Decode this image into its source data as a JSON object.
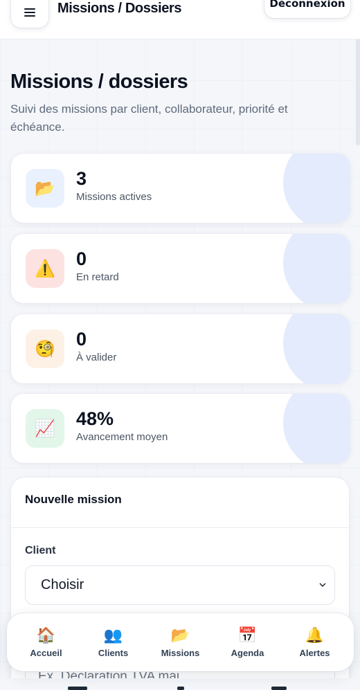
{
  "header": {
    "title": "Missions / Dossiers",
    "logout_label": "Déconnexion"
  },
  "page": {
    "title": "Missions / dossiers",
    "subtitle": "Suivi des missions par client, collaborateur, priorité et échéance."
  },
  "stats": [
    {
      "icon": "folder-icon",
      "glyph": "📂",
      "value": "3",
      "label": "Missions actives",
      "icon_bg": "#eaf1fe"
    },
    {
      "icon": "warning-icon",
      "glyph": "⚠️",
      "value": "0",
      "label": "En retard",
      "icon_bg": "#fde2e2"
    },
    {
      "icon": "monocle-face-icon",
      "glyph": "🧐",
      "value": "0",
      "label": "À valider",
      "icon_bg": "#fdf1e6"
    },
    {
      "icon": "chart-increasing-icon",
      "glyph": "📈",
      "value": "48%",
      "label": "Avancement moyen",
      "icon_bg": "#e2f6e9"
    }
  ],
  "form": {
    "title": "Nouvelle mission",
    "client_label": "Client",
    "client_selected": "Choisir",
    "mission_placeholder": "Ex. Déclaration TVA mai"
  },
  "nav": [
    {
      "icon": "house-icon",
      "glyph": "🏠",
      "label": "Accueil"
    },
    {
      "icon": "people-icon",
      "glyph": "👥",
      "label": "Clients"
    },
    {
      "icon": "folder-icon",
      "glyph": "📂",
      "label": "Missions"
    },
    {
      "icon": "calendar-icon",
      "glyph": "📅",
      "label": "Agenda"
    },
    {
      "icon": "bell-icon",
      "glyph": "🔔",
      "label": "Alertes"
    }
  ],
  "colors": {
    "accent_blob": "#e3ebfd",
    "text_primary": "#0b1220",
    "text_muted": "#5f6b7b"
  }
}
